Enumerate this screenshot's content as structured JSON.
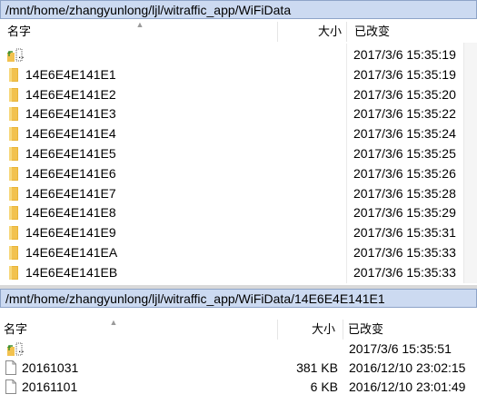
{
  "top_panel": {
    "path": "/mnt/home/zhangyunlong/ljl/witraffic_app/WiFiData",
    "columns": {
      "name": "名字",
      "size": "大小",
      "modified": "已改变"
    },
    "rows": [
      {
        "name": "..",
        "icon": "parent-folder-icon",
        "size": "",
        "modified": "2017/3/6 15:35:19"
      },
      {
        "name": "14E6E4E141E1",
        "icon": "folder-icon",
        "size": "",
        "modified": "2017/3/6 15:35:19"
      },
      {
        "name": "14E6E4E141E2",
        "icon": "folder-icon",
        "size": "",
        "modified": "2017/3/6 15:35:20"
      },
      {
        "name": "14E6E4E141E3",
        "icon": "folder-icon",
        "size": "",
        "modified": "2017/3/6 15:35:22"
      },
      {
        "name": "14E6E4E141E4",
        "icon": "folder-icon",
        "size": "",
        "modified": "2017/3/6 15:35:24"
      },
      {
        "name": "14E6E4E141E5",
        "icon": "folder-icon",
        "size": "",
        "modified": "2017/3/6 15:35:25"
      },
      {
        "name": "14E6E4E141E6",
        "icon": "folder-icon",
        "size": "",
        "modified": "2017/3/6 15:35:26"
      },
      {
        "name": "14E6E4E141E7",
        "icon": "folder-icon",
        "size": "",
        "modified": "2017/3/6 15:35:28"
      },
      {
        "name": "14E6E4E141E8",
        "icon": "folder-icon",
        "size": "",
        "modified": "2017/3/6 15:35:29"
      },
      {
        "name": "14E6E4E141E9",
        "icon": "folder-icon",
        "size": "",
        "modified": "2017/3/6 15:35:31"
      },
      {
        "name": "14E6E4E141EA",
        "icon": "folder-icon",
        "size": "",
        "modified": "2017/3/6 15:35:33"
      },
      {
        "name": "14E6E4E141EB",
        "icon": "folder-icon",
        "size": "",
        "modified": "2017/3/6 15:35:33"
      }
    ]
  },
  "bottom_panel": {
    "path": "/mnt/home/zhangyunlong/ljl/witraffic_app/WiFiData/14E6E4E141E1",
    "columns": {
      "name": "名字",
      "size": "大小",
      "modified": "已改变"
    },
    "rows": [
      {
        "name": "..",
        "icon": "parent-folder-icon",
        "size": "",
        "modified": "2017/3/6 15:35:51"
      },
      {
        "name": "20161031",
        "icon": "file-icon",
        "size": "381 KB",
        "modified": "2016/12/10 23:02:15"
      },
      {
        "name": "20161101",
        "icon": "file-icon",
        "size": "6 KB",
        "modified": "2016/12/10 23:01:49"
      }
    ]
  },
  "colors": {
    "pathbar_bg": "#ccdaf1",
    "folder_yellow": "#f2c24f",
    "up_arrow_green": "#3f8f2e"
  }
}
